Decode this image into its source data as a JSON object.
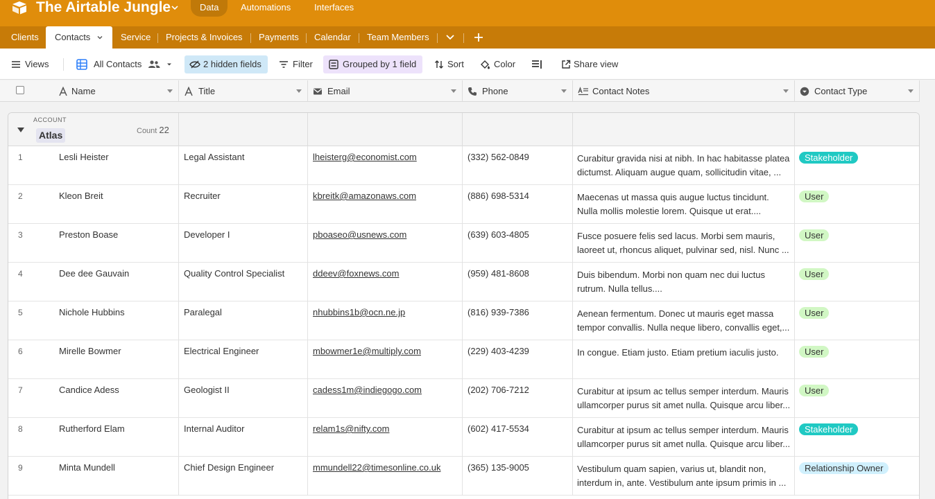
{
  "app": {
    "base_title": "The Airtable Jungle",
    "top_tabs": {
      "data": "Data",
      "automations": "Automations",
      "interfaces": "Interfaces"
    }
  },
  "tables": {
    "clients": "Clients",
    "contacts": "Contacts",
    "service": "Service",
    "projects": "Projects & Invoices",
    "payments": "Payments",
    "calendar": "Calendar",
    "team": "Team Members"
  },
  "toolbar": {
    "views": "Views",
    "view_name": "All Contacts",
    "hidden_fields": "2 hidden fields",
    "filter": "Filter",
    "grouped": "Grouped by 1 field",
    "sort": "Sort",
    "color": "Color",
    "share": "Share view"
  },
  "columns": {
    "name": "Name",
    "title": "Title",
    "email": "Email",
    "phone": "Phone",
    "notes": "Contact Notes",
    "type": "Contact Type"
  },
  "group": {
    "field_label": "ACCOUNT",
    "value": "Atlas",
    "count_label": "Count",
    "count": "22"
  },
  "rows": [
    {
      "num": "1",
      "name": "Lesli Heister",
      "title": "Legal Assistant",
      "email": "lheisterg@economist.com",
      "phone": "(332) 562-0849",
      "notes": "Curabitur gravida nisi at nibh. In hac habitasse platea dictumst. Aliquam augue quam, sollicitudin vitae, ...",
      "type": "Stakeholder"
    },
    {
      "num": "2",
      "name": "Kleon Breit",
      "title": "Recruiter",
      "email": "kbreitk@amazonaws.com",
      "phone": "(886) 698-5314",
      "notes": "Maecenas ut massa quis augue luctus tincidunt. Nulla mollis molestie lorem. Quisque ut erat....",
      "type": "User"
    },
    {
      "num": "3",
      "name": "Preston Boase",
      "title": "Developer I",
      "email": "pboaseo@usnews.com",
      "phone": "(639) 603-4805",
      "notes": "Fusce posuere felis sed lacus. Morbi sem mauris, laoreet ut, rhoncus aliquet, pulvinar sed, nisl. Nunc ...",
      "type": "User"
    },
    {
      "num": "4",
      "name": "Dee dee Gauvain",
      "title": "Quality Control Specialist",
      "email": "ddeev@foxnews.com",
      "phone": "(959) 481-8608",
      "notes": "Duis bibendum. Morbi non quam nec dui luctus rutrum. Nulla tellus....",
      "type": "User"
    },
    {
      "num": "5",
      "name": "Nichole Hubbins",
      "title": "Paralegal",
      "email": "nhubbins1b@ocn.ne.jp",
      "phone": "(816) 939-7386",
      "notes": "Aenean fermentum. Donec ut mauris eget massa tempor convallis. Nulla neque libero, convallis eget,...",
      "type": "User"
    },
    {
      "num": "6",
      "name": "Mirelle Bowmer",
      "title": "Electrical Engineer",
      "email": "mbowmer1e@multiply.com",
      "phone": "(229) 403-4239",
      "notes": "In congue. Etiam justo. Etiam pretium iaculis justo.",
      "type": "User"
    },
    {
      "num": "7",
      "name": "Candice Adess",
      "title": "Geologist II",
      "email": "cadess1m@indiegogo.com",
      "phone": "(202) 706-7212",
      "notes": "Curabitur at ipsum ac tellus semper interdum. Mauris ullamcorper purus sit amet nulla. Quisque arcu liber...",
      "type": "User"
    },
    {
      "num": "8",
      "name": "Rutherford Elam",
      "title": "Internal Auditor",
      "email": "relam1s@nifty.com",
      "phone": "(602) 417-5534",
      "notes": "Curabitur at ipsum ac tellus semper interdum. Mauris ullamcorper purus sit amet nulla. Quisque arcu liber...",
      "type": "Stakeholder"
    },
    {
      "num": "9",
      "name": "Minta Mundell",
      "title": "Chief Design Engineer",
      "email": "mmundell22@timesonline.co.uk",
      "phone": "(365) 135-9005",
      "notes": "Vestibulum quam sapien, varius ut, blandit non, interdum in, ante. Vestibulum ante ipsum primis in ...",
      "type": "Relationship Owner"
    }
  ],
  "type_colors": {
    "Stakeholder": {
      "bg": "#20c9c3",
      "fg": "#ffffff"
    },
    "User": {
      "bg": "#d1f7c4",
      "fg": "#333333"
    },
    "Relationship Owner": {
      "bg": "#d0f0fd",
      "fg": "#333333"
    }
  },
  "colors": {
    "topbar": "#e08d0b",
    "tabbar": "#c77b08",
    "hidden_fields_bg": "#cfe8f7",
    "grouped_bg": "#ede2fb"
  }
}
